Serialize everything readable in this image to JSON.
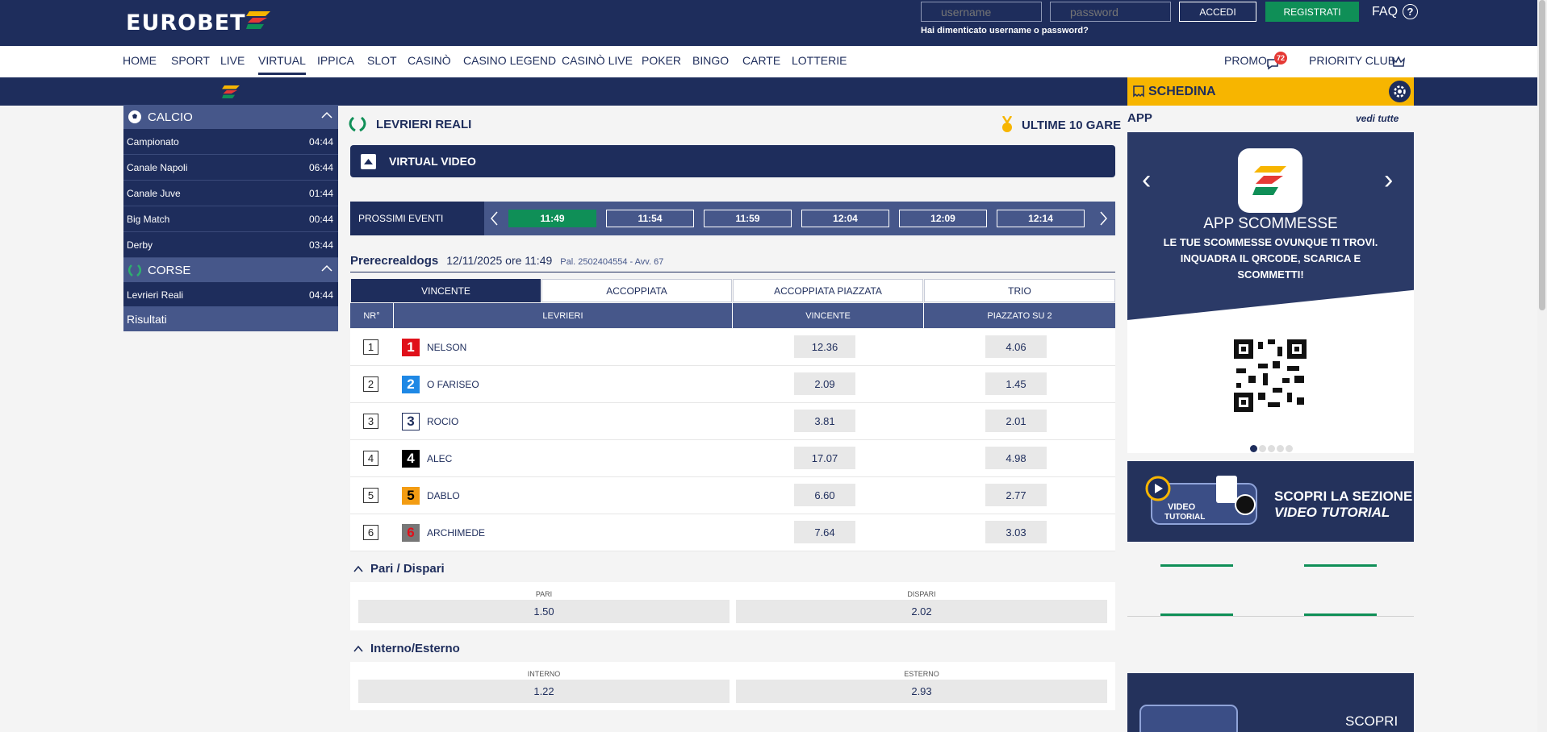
{
  "header": {
    "logo": "EUROBET",
    "username_placeholder": "username",
    "password_placeholder": "password",
    "login_label": "ACCEDI",
    "register_label": "REGISTRATI",
    "faq_label": "FAQ",
    "forgot_label": "Hai dimenticato username o password?"
  },
  "nav": {
    "items": [
      "HOME",
      "SPORT",
      "LIVE",
      "VIRTUAL",
      "IPPICA",
      "SLOT",
      "CASINÒ",
      "CASINO LEGEND",
      "CASINÒ LIVE",
      "POKER",
      "BINGO",
      "CARTE",
      "LOTTERIE"
    ],
    "active": "VIRTUAL",
    "promo_label": "PROMO",
    "promo_count": "72",
    "priority_label": "PRIORITY CLUB"
  },
  "sidebar": {
    "calcio_title": "CALCIO",
    "calcio_items": [
      {
        "label": "Campionato",
        "time": "04:44"
      },
      {
        "label": "Canale Napoli",
        "time": "06:44"
      },
      {
        "label": "Canale Juve",
        "time": "01:44"
      },
      {
        "label": "Big Match",
        "time": "00:44"
      },
      {
        "label": "Derby",
        "time": "03:44"
      }
    ],
    "corse_title": "CORSE",
    "corse_items": [
      {
        "label": "Levrieri Reali",
        "time": "04:44"
      }
    ],
    "risultati_label": "Risultati"
  },
  "main": {
    "title": "LEVRIERI REALI",
    "ultime_label": "ULTIME 10 GARE",
    "virtual_video_label": "VIRTUAL VIDEO",
    "prossimi_label": "PROSSIMI EVENTI",
    "slots": [
      "11:49",
      "11:54",
      "11:59",
      "12:04",
      "12:09",
      "12:14"
    ],
    "event_name": "Prerecrealdogs",
    "event_date": "12/11/2025 ore 11:49",
    "event_pal": "Pal. 2502404554 - Avv. 67",
    "tabs": [
      "VINCENTE",
      "ACCOPPIATA",
      "ACCOPPIATA PIAZZATA",
      "TRIO"
    ],
    "columns": [
      "NR°",
      "LEVRIERI",
      "VINCENTE",
      "PIAZZATO SU 2"
    ],
    "runners": [
      {
        "nr": "1",
        "name": "NELSON",
        "vincente": "12.36",
        "piazzato": "4.06",
        "color": "#e0101a",
        "text_color": "#ffffff"
      },
      {
        "nr": "2",
        "name": "O FARISEO",
        "vincente": "2.09",
        "piazzato": "1.45",
        "color": "#1e88e5",
        "text_color": "#ffffff"
      },
      {
        "nr": "3",
        "name": "ROCIO",
        "vincente": "3.81",
        "piazzato": "2.01",
        "color": "#ffffff",
        "text_color": "#1e2d5c"
      },
      {
        "nr": "4",
        "name": "ALEC",
        "vincente": "17.07",
        "piazzato": "4.98",
        "color": "#000000",
        "text_color": "#ffffff"
      },
      {
        "nr": "5",
        "name": "DABLO",
        "vincente": "6.60",
        "piazzato": "2.77",
        "color": "#f39c12",
        "text_color": "#000000"
      },
      {
        "nr": "6",
        "name": "ARCHIMEDE",
        "vincente": "7.64",
        "piazzato": "3.03",
        "color": "#777777",
        "text_color": "#e0101a"
      }
    ],
    "pari_title": "Pari / Dispari",
    "pari_label": "PARI",
    "pari_odd": "1.50",
    "dispari_label": "DISPARI",
    "dispari_odd": "2.02",
    "interno_title": "Interno/Esterno",
    "interno_label": "INTERNO",
    "interno_odd": "1.22",
    "esterno_label": "ESTERNO",
    "esterno_odd": "2.93"
  },
  "right": {
    "schedina_label": "SCHEDINA",
    "app_label": "APP",
    "vedi_tutte": "vedi tutte",
    "app_title": "APP SCOMMESSE",
    "app_subtitle": "LE TUE SCOMMESSE OVUNQUE TI TROVI. INQUADRA IL QRCODE, SCARICA E SCOMMETTI!",
    "tutorial_line1": "SCOPRI LA SEZIONE",
    "tutorial_line2": "VIDEO TUTORIAL",
    "bottom_label": "SCOPRI"
  },
  "colors": {
    "navy": "#1e2d5c",
    "accent_green": "#0f8f57",
    "schedina_yellow": "#f7b500"
  }
}
